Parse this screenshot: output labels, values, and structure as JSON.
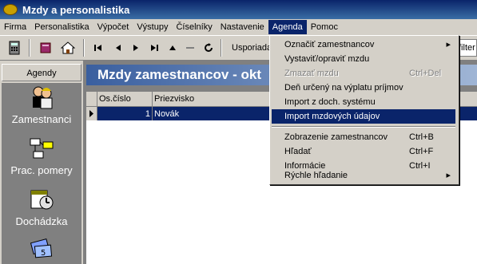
{
  "window": {
    "title": "Mzdy a personalistika"
  },
  "menu": [
    "Firma",
    "Personalistika",
    "Výpočet",
    "Výstupy",
    "Číselníky",
    "Nastavenie",
    "Agenda",
    "Pomoc"
  ],
  "toolbar": {
    "sort_label": "Usporiada",
    "filter_label": "filter"
  },
  "sidebar": {
    "header": "Agendy",
    "items": [
      {
        "label": "Zamestnanci",
        "icon": "employees-icon"
      },
      {
        "label": "Prac. pomery",
        "icon": "org-chart-icon"
      },
      {
        "label": "Dochádzka",
        "icon": "calendar-clock-icon"
      },
      {
        "label": "",
        "icon": "money-icon"
      }
    ]
  },
  "main": {
    "banner": "Mzdy zamestnancov - okt",
    "columns": [
      "Os.číslo",
      "Priezvisko"
    ],
    "rows": [
      {
        "os": "1",
        "name": "Novák"
      }
    ]
  },
  "agenda_menu": {
    "items": [
      {
        "label": "Označiť zamestnancov",
        "shortcut": "",
        "submenu": true,
        "disabled": false,
        "selected": false
      },
      {
        "label": "Vystaviť/opraviť mzdu",
        "shortcut": "",
        "submenu": false,
        "disabled": false,
        "selected": false
      },
      {
        "label": "Zmazať mzdu",
        "shortcut": "Ctrl+Del",
        "submenu": false,
        "disabled": true,
        "selected": false
      },
      {
        "label": "Deň určený na výplatu príjmov",
        "shortcut": "",
        "submenu": false,
        "disabled": false,
        "selected": false
      },
      {
        "label": "Import z doch. systému",
        "shortcut": "",
        "submenu": false,
        "disabled": false,
        "selected": false
      },
      {
        "label": "Import mzdových údajov",
        "shortcut": "",
        "submenu": false,
        "disabled": false,
        "selected": true
      },
      {
        "label": "Zobrazenie zamestnancov",
        "shortcut": "Ctrl+B",
        "submenu": false,
        "disabled": false,
        "selected": false
      },
      {
        "label": "Hľadať",
        "shortcut": "Ctrl+F",
        "submenu": false,
        "disabled": false,
        "selected": false
      },
      {
        "label": "Informácie",
        "shortcut": "Ctrl+I",
        "submenu": false,
        "disabled": false,
        "selected": false
      },
      {
        "label": "Rýchle hľadanie",
        "shortcut": "",
        "submenu": true,
        "disabled": false,
        "selected": false
      }
    ]
  },
  "colors": {
    "title_bar": "#0a246a",
    "menu_highlight": "#0a246a",
    "row_highlight": "#0a246a",
    "chrome": "#d4d0c8"
  }
}
